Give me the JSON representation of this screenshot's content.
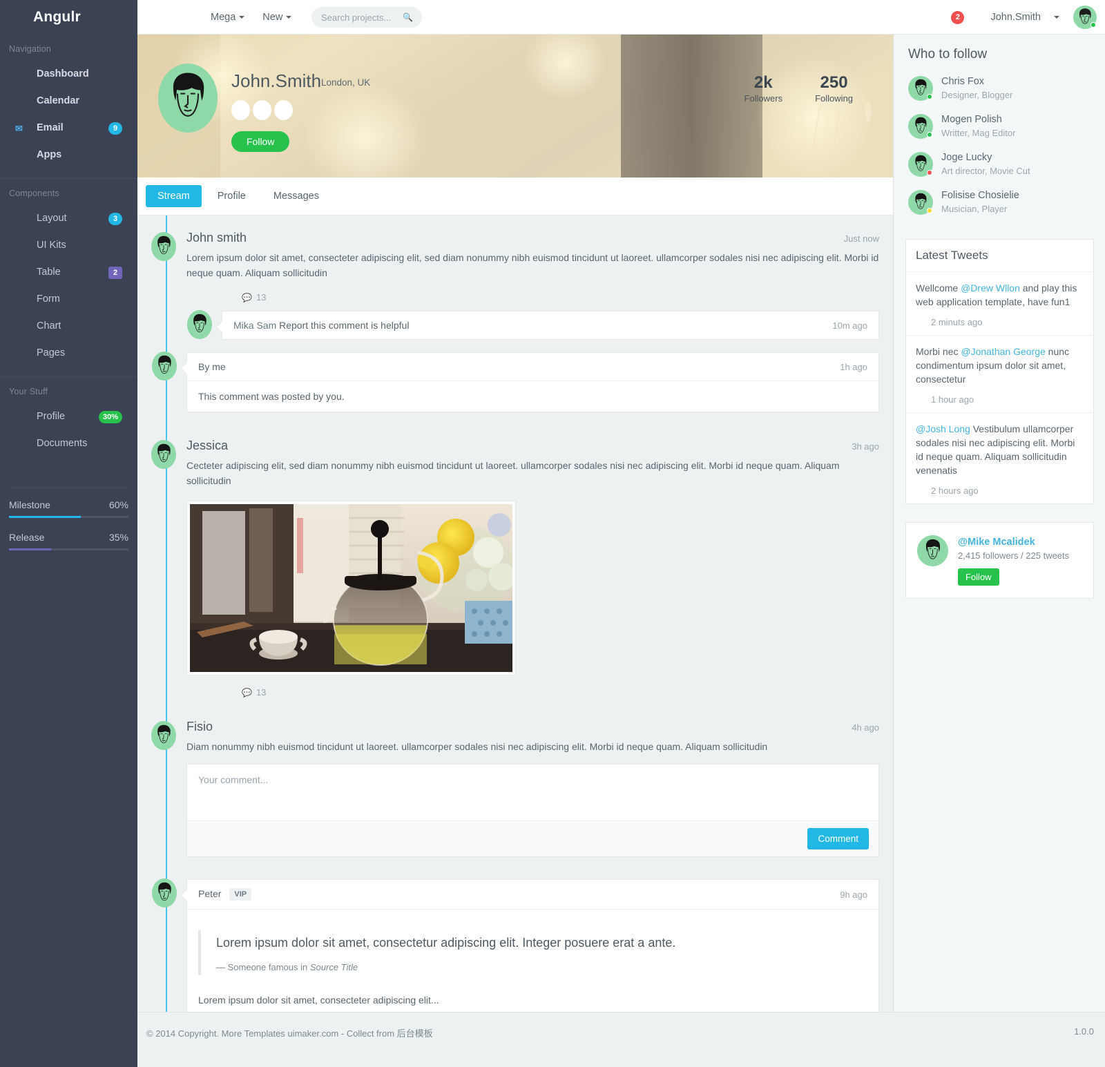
{
  "brand": "Angulr",
  "sidebar": {
    "groups": [
      {
        "title": "Navigation",
        "items": [
          {
            "label": "Dashboard",
            "icon": "",
            "badge": null
          },
          {
            "label": "Calendar",
            "icon": "",
            "badge": null
          },
          {
            "label": "Email",
            "icon": "envelope-icon",
            "badge": "9",
            "badge_type": "info"
          },
          {
            "label": "Apps",
            "icon": "",
            "badge": null
          }
        ]
      },
      {
        "title": "Components",
        "items": [
          {
            "label": "Layout",
            "icon": "",
            "badge": "3",
            "badge_type": "info"
          },
          {
            "label": "UI Kits",
            "icon": "",
            "badge": null
          },
          {
            "label": "Table",
            "icon": "",
            "badge": "2",
            "badge_type": "purple"
          },
          {
            "label": "Form",
            "icon": "",
            "badge": null
          },
          {
            "label": "Chart",
            "icon": "",
            "badge": null
          },
          {
            "label": "Pages",
            "icon": "",
            "badge": null
          }
        ]
      },
      {
        "title": "Your Stuff",
        "items": [
          {
            "label": "Profile",
            "icon": "",
            "badge": "30%",
            "badge_type": "success"
          },
          {
            "label": "Documents",
            "icon": "",
            "badge": null
          }
        ]
      }
    ],
    "meters": [
      {
        "label": "Milestone",
        "value": "60%",
        "percent": 60,
        "color": "#23b7e5"
      },
      {
        "label": "Release",
        "value": "35%",
        "percent": 35,
        "color": "#7266ba"
      }
    ]
  },
  "topbar": {
    "mega_label": "Mega",
    "new_label": "New",
    "search_placeholder": "Search projects...",
    "search_value": "",
    "alert_count": "2",
    "user_name": "John.Smith"
  },
  "profile": {
    "name": "John.Smith",
    "location": "London, UK",
    "follow_label": "Follow",
    "followers_value": "2k",
    "followers_label": "Followers",
    "following_value": "250",
    "following_label": "Following"
  },
  "tabs": [
    {
      "label": "Stream",
      "active": true
    },
    {
      "label": "Profile",
      "active": false
    },
    {
      "label": "Messages",
      "active": false
    }
  ],
  "stream": {
    "post1": {
      "author": "John smith",
      "time": "Just now",
      "body": "Lorem ipsum dolor sit amet, consecteter adipiscing elit, sed diam nonummy nibh euismod tincidunt ut laoreet. ullamcorper sodales nisi nec adipiscing elit. Morbi id neque quam. Aliquam sollicitudin",
      "comment_count": "13"
    },
    "comment1": {
      "author": "Mika Sam",
      "text": "Report this comment is helpful",
      "time": "10m ago"
    },
    "comment2": {
      "head": "By me",
      "time": "1h ago",
      "body": "This comment was posted by you."
    },
    "post2": {
      "author": "Jessica",
      "time": "3h ago",
      "body": "Cecteter adipiscing elit, sed diam nonummy nibh euismod tincidunt ut laoreet. ullamcorper sodales nisi nec adipiscing elit. Morbi id neque quam. Aliquam sollicitudin",
      "image_alt": "teapot-photo",
      "comment_count": "13"
    },
    "post3": {
      "author": "Fisio",
      "time": "4h ago",
      "body": "Diam nonummy nibh euismod tincidunt ut laoreet. ullamcorper sodales nisi nec adipiscing elit. Morbi id neque quam. Aliquam sollicitudin"
    },
    "comment_form": {
      "placeholder": "Your comment...",
      "value": "",
      "submit_label": "Comment"
    },
    "post4": {
      "author": "Peter",
      "badge": "VIP",
      "time": "9h ago",
      "quote": "Lorem ipsum dolor sit amet, consectetur adipiscing elit. Integer posuere erat a ante.",
      "quote_attrib_prefix": "— Someone famous in ",
      "quote_source": "Source Title",
      "body": "Lorem ipsum dolor sit amet, consecteter adipiscing elit..."
    }
  },
  "right": {
    "who_to_follow_title": "Who to follow",
    "people": [
      {
        "name": "Chris Fox",
        "role": "Designer, Blogger",
        "status": "green"
      },
      {
        "name": "Mogen Polish",
        "role": "Writter, Mag Editor",
        "status": "green"
      },
      {
        "name": "Joge Lucky",
        "role": "Art director, Movie Cut",
        "status": "red"
      },
      {
        "name": "Folisise Chosielie",
        "role": "Musician, Player",
        "status": "yellow"
      }
    ],
    "tweets_title": "Latest Tweets",
    "tweets": [
      {
        "pre": "Wellcome ",
        "handle": "@Drew Wllon",
        "post": " and play this web application template, have fun1",
        "time": "2 minuts ago"
      },
      {
        "pre": "Morbi nec ",
        "handle": "@Jonathan George",
        "post": " nunc condimentum ipsum dolor sit amet, consectetur",
        "time": "1 hour ago"
      },
      {
        "pre": "",
        "handle": "@Josh Long",
        "post": " Vestibulum ullamcorper sodales nisi nec adipiscing elit. Morbi id neque quam. Aliquam sollicitudin venenatis",
        "time": "2 hours ago"
      }
    ],
    "twitter_card": {
      "handle": "@Mike Mcalidek",
      "meta": "2,415 followers / 225 tweets",
      "follow_label": "Follow"
    }
  },
  "footer": {
    "copyright_pre": "© 2014 Copyright. More Templates ",
    "link": "uimaker.com",
    "copyright_post": " - Collect from 后台模板",
    "version": "1.0.0"
  },
  "colors": {
    "sidebar_bg": "#3a4254",
    "accent_info": "#23b7e5",
    "accent_success": "#27c24c",
    "accent_purple": "#7266ba",
    "accent_danger": "#f05050",
    "page_bg": "#edf1f2"
  }
}
